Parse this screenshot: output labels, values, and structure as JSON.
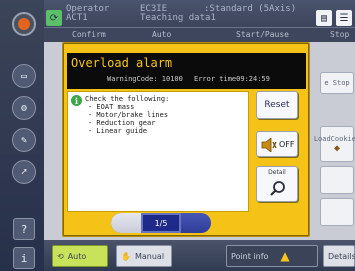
{
  "header": {
    "operator_label": "Operator",
    "operator_sub": "ACT1",
    "controller_name": "EC3IE",
    "controller_sub": "Teaching data1",
    "mode": ":Standard (5Axis)"
  },
  "top_tabs": [
    "Confirm",
    "Auto",
    "Start/Pause",
    "Stop"
  ],
  "side_labels": {
    "stop": "e Stop",
    "load_cookies": "LoadCookies"
  },
  "bottom": {
    "auto_label": "Auto",
    "manual_label": "Manual",
    "point_info_label": "Point info",
    "details_label": "Details"
  },
  "alarm": {
    "title": "Overload alarm",
    "warning_code": "WarningCode: 10100",
    "error_time": "Error time09:24:59",
    "heading": "Check the following:",
    "items": [
      "- EOAT mass",
      "- Motor/brake lines",
      "- Reduction gear",
      "- Linear guide"
    ],
    "reset_label": "Reset",
    "off_label": "OFF",
    "detail_label": "Detail",
    "page": "1/5"
  },
  "colors": {
    "popup": "#f5c317",
    "title_bg": "#0b0b0b",
    "title_text": "#f7c61c",
    "pager": "#1f2b8a"
  },
  "icons": [
    "power-icon",
    "lock-icon",
    "menu-icon",
    "info-icon",
    "sound-off-icon",
    "magnifier-icon",
    "warning-icon",
    "question-icon"
  ]
}
